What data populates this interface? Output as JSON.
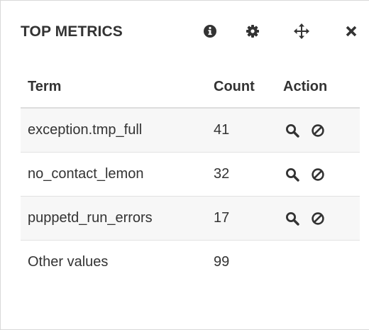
{
  "panel": {
    "title": "TOP METRICS",
    "header_icons": [
      "info-icon",
      "gear-icon",
      "move-icon",
      "close-icon"
    ]
  },
  "table": {
    "columns": [
      "Term",
      "Count",
      "Action"
    ],
    "rows": [
      {
        "term": "exception.tmp_full",
        "count": "41",
        "actions": [
          "search-icon",
          "ban-icon"
        ]
      },
      {
        "term": "no_contact_lemon",
        "count": "32",
        "actions": [
          "search-icon",
          "ban-icon"
        ]
      },
      {
        "term": "puppetd_run_errors",
        "count": "17",
        "actions": [
          "search-icon",
          "ban-icon"
        ]
      },
      {
        "term": "Other values",
        "count": "99",
        "actions": []
      }
    ]
  },
  "colors": {
    "text": "#333333",
    "row_stripe": "#f7f7f7",
    "border": "#dddddd"
  }
}
